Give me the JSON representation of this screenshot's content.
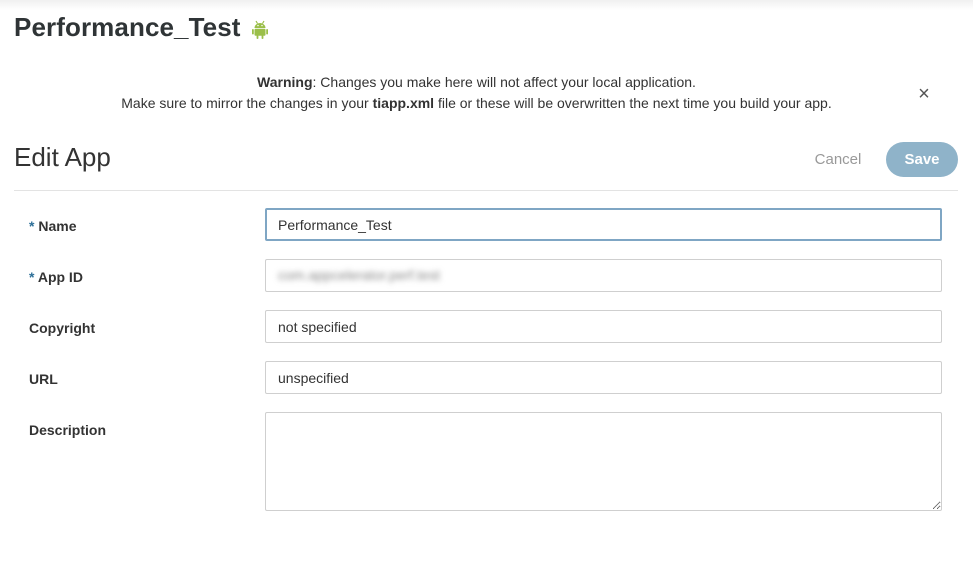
{
  "app_title": "Performance_Test",
  "warning": {
    "bold_label": "Warning",
    "line1_rest": ": Changes you make here will not affect your local application.",
    "line2_before": "Make sure to mirror the changes in your ",
    "line2_file": "tiapp.xml",
    "line2_after": " file or these will be overwritten the next time you build your app.",
    "close_glyph": "×"
  },
  "form": {
    "title": "Edit App",
    "cancel_label": "Cancel",
    "save_label": "Save",
    "required_marker": "*",
    "fields": {
      "name": {
        "label": "Name",
        "value": "Performance_Test"
      },
      "app_id": {
        "label": "App ID",
        "value": "com.appcelerator.perf.test"
      },
      "copyright": {
        "label": "Copyright",
        "value": "not specified"
      },
      "url": {
        "label": "URL",
        "value": "unspecified"
      },
      "description": {
        "label": "Description",
        "value": ""
      }
    }
  },
  "colors": {
    "android_green": "#9bbf4a",
    "save_button": "#8fb3c9",
    "required_marker": "#2d6f98"
  }
}
